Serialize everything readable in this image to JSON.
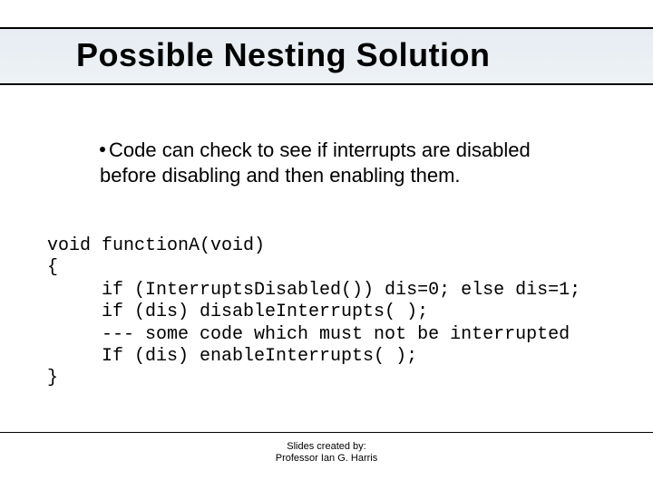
{
  "title": "Possible Nesting Solution",
  "bullet": "Code can check to see if interrupts are disabled before disabling and then enabling them.",
  "code": "void functionA(void)\n{\n     if (InterruptsDisabled()) dis=0; else dis=1;\n     if (dis) disableInterrupts( );\n     --- some code which must not be interrupted\n     If (dis) enableInterrupts( );\n}",
  "footer": {
    "line1": "Slides created by:",
    "line2": "Professor Ian G. Harris"
  }
}
